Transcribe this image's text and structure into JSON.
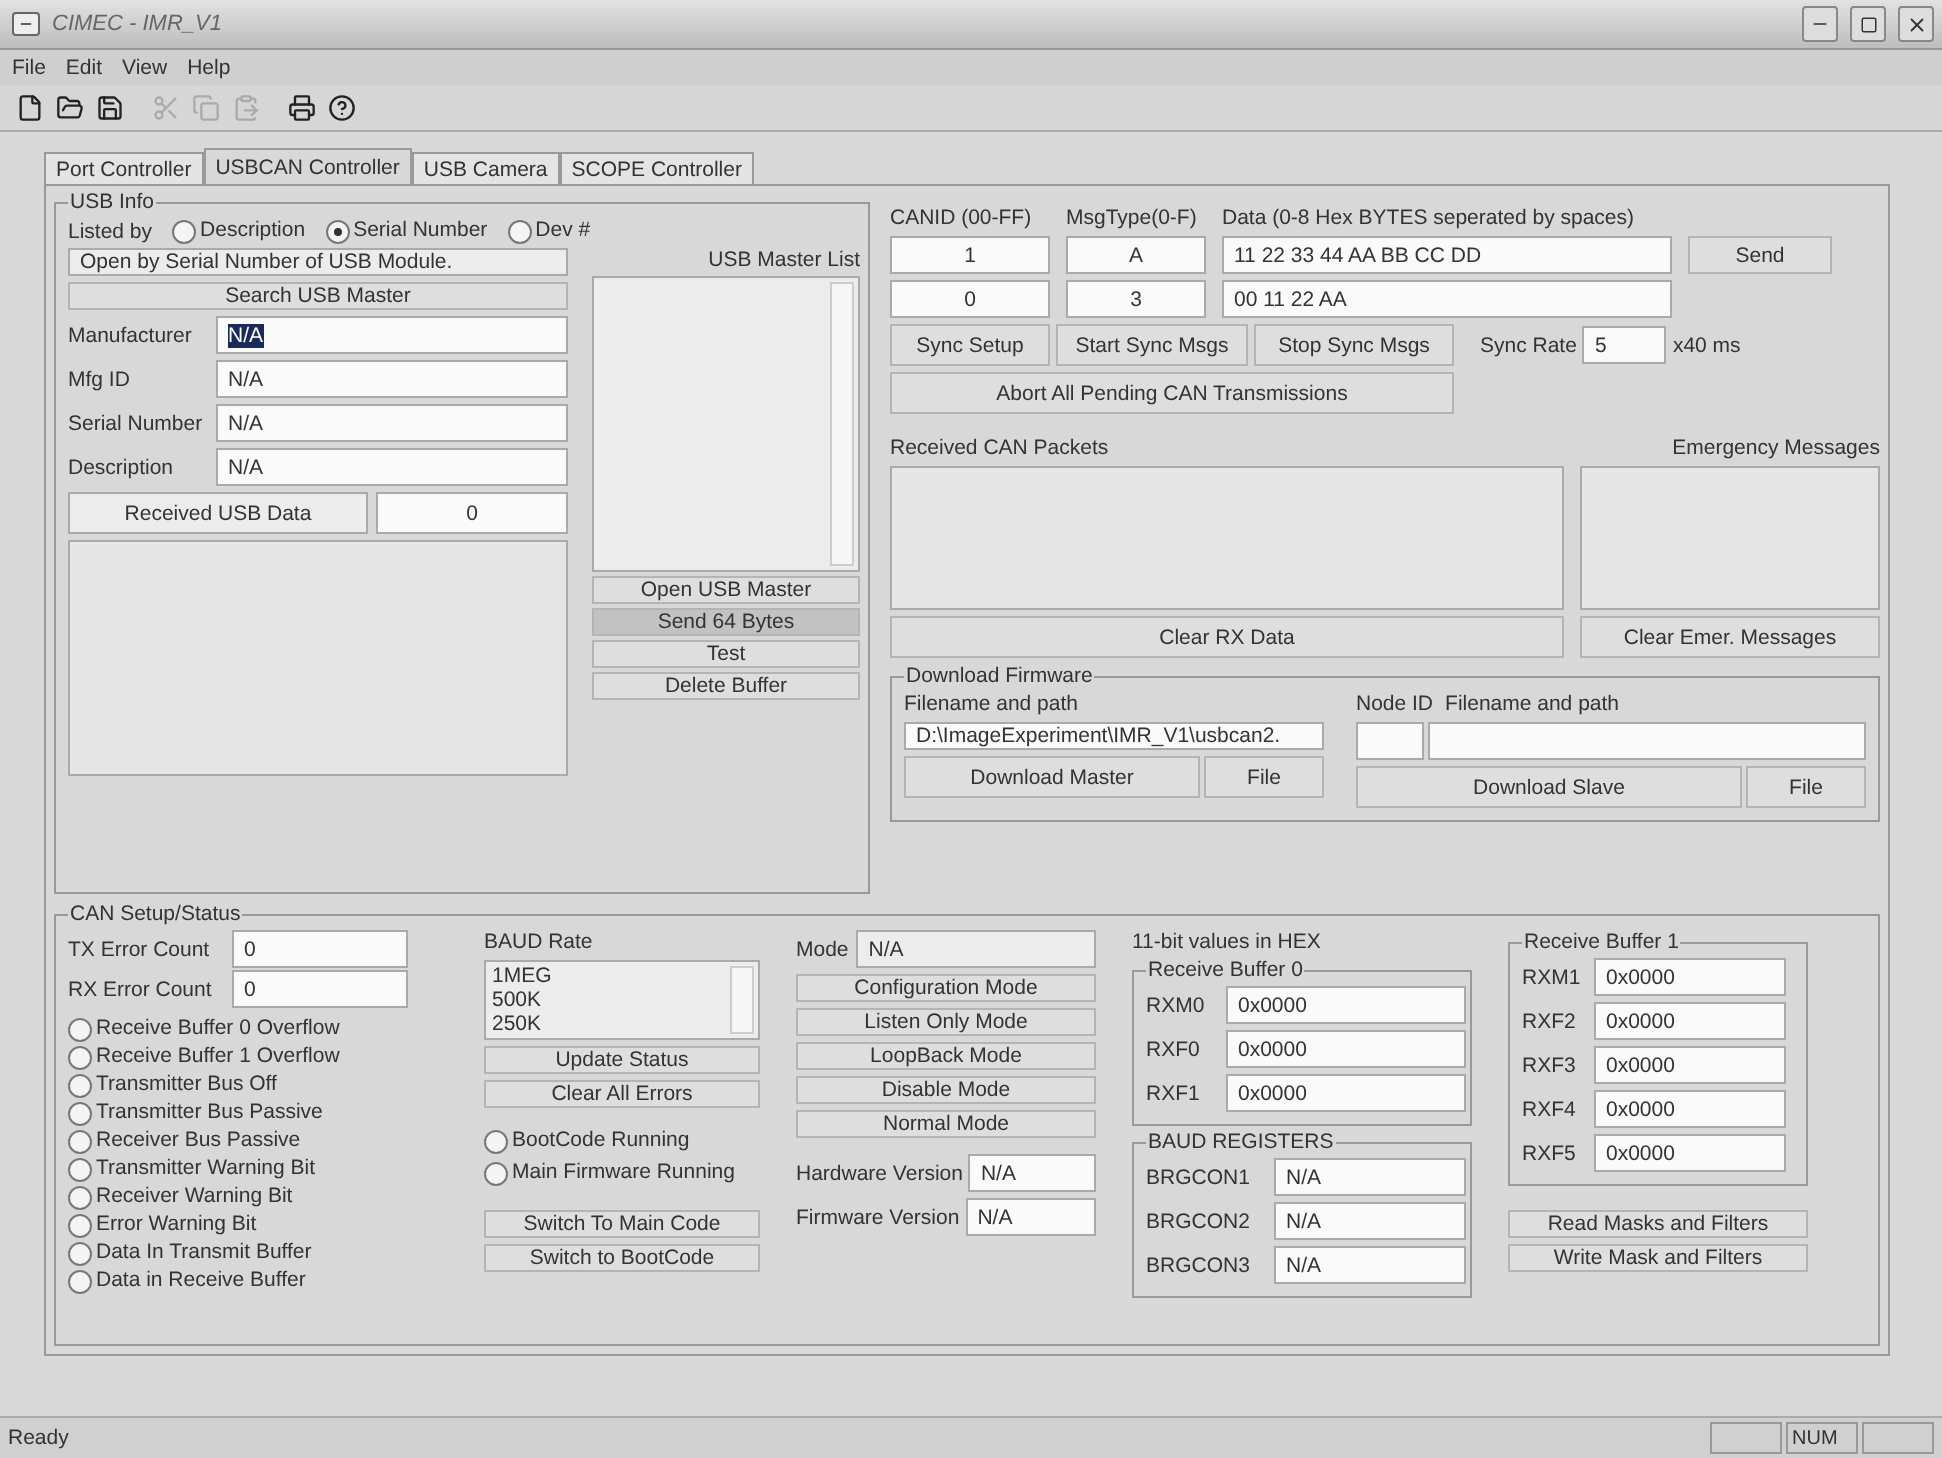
{
  "window": {
    "title": "CIMEC - IMR_V1"
  },
  "menu": [
    "File",
    "Edit",
    "View",
    "Help"
  ],
  "toolbar": [
    {
      "kind": "new",
      "disabled": false
    },
    {
      "kind": "open",
      "disabled": false
    },
    {
      "kind": "save",
      "disabled": false
    },
    {
      "kind": "cut",
      "disabled": true
    },
    {
      "kind": "copy",
      "disabled": true
    },
    {
      "kind": "paste",
      "disabled": true
    },
    {
      "kind": "print",
      "disabled": false
    },
    {
      "kind": "help",
      "disabled": false
    }
  ],
  "tabs": [
    {
      "label": "Port Controller",
      "selected": false
    },
    {
      "label": "USBCAN Controller",
      "selected": true
    },
    {
      "label": "USB Camera",
      "selected": false
    },
    {
      "label": "SCOPE Controller",
      "selected": false
    }
  ],
  "usb_info": {
    "title": "USB Info",
    "listed_by": "Listed by",
    "options": [
      {
        "label": "Description",
        "selected": false
      },
      {
        "label": "Serial Number",
        "selected": true
      },
      {
        "label": "Dev #",
        "selected": false
      }
    ],
    "master_list_label": "USB Master List",
    "hint": "Open by Serial Number of USB Module.",
    "search_button": "Search USB Master",
    "fields": [
      {
        "label": "Manufacturer",
        "value": "N/A",
        "highlighted": true
      },
      {
        "label": "Mfg ID",
        "value": "N/A",
        "highlighted": false
      },
      {
        "label": "Serial Number",
        "value": "N/A",
        "highlighted": false
      },
      {
        "label": "Description",
        "value": "N/A",
        "highlighted": false
      }
    ],
    "received_label": "Received USB Data",
    "received_count": "0",
    "buttons": [
      {
        "label": "Open USB Master",
        "pressed": false
      },
      {
        "label": "Send 64 Bytes",
        "pressed": true
      },
      {
        "label": "Test",
        "pressed": false
      },
      {
        "label": "Delete Buffer",
        "pressed": false
      }
    ]
  },
  "can_send": {
    "headers": [
      "CANID (00-FF)",
      "MsgType(0-F)",
      "Data (0-8 Hex BYTES seperated by spaces)"
    ],
    "rows": [
      {
        "canid": "1",
        "msgtype": "A",
        "data": "11 22 33 44 AA BB CC DD"
      },
      {
        "canid": "0",
        "msgtype": "3",
        "data": "00 11 22 AA"
      }
    ],
    "send_button": "Send",
    "sync_buttons": [
      "Sync Setup",
      "Start Sync Msgs",
      "Stop Sync Msgs"
    ],
    "sync_rate_label": "Sync Rate",
    "sync_rate": "5",
    "sync_rate_unit": "x40 ms",
    "abort_button": "Abort All Pending CAN Transmissions"
  },
  "received": {
    "packets_label": "Received CAN Packets",
    "emergency_label": "Emergency Messages",
    "clear_rx_button": "Clear RX Data",
    "clear_emer_button": "Clear Emer. Messages"
  },
  "firmware": {
    "title": "Download Firmware",
    "master_label": "Filename and path",
    "master_path": "D:\\ImageExperiment\\IMR_V1\\usbcan2.",
    "node_id_label": "Node ID",
    "slave_label": "Filename and path",
    "download_master": "Download Master",
    "master_file": "File",
    "download_slave": "Download Slave",
    "slave_file": "File"
  },
  "can_setup": {
    "title": "CAN Setup/Status",
    "tx_label": "TX Error Count",
    "tx_value": "0",
    "rx_label": "RX Error Count",
    "rx_value": "0",
    "flags": [
      {
        "label": "Receive Buffer 0 Overflow",
        "on": false
      },
      {
        "label": "Receive Buffer 1 Overflow",
        "on": false
      },
      {
        "label": "Transmitter Bus Off",
        "on": false
      },
      {
        "label": "Transmitter Bus Passive",
        "on": false
      },
      {
        "label": "Receiver Bus Passive",
        "on": false
      },
      {
        "label": "Transmitter Warning Bit",
        "on": false
      },
      {
        "label": "Receiver Warning Bit",
        "on": false
      },
      {
        "label": "Error Warning Bit",
        "on": false
      },
      {
        "label": "Data In Transmit Buffer",
        "on": false
      },
      {
        "label": "Data in Receive Buffer",
        "on": false
      }
    ],
    "baud_label": "BAUD Rate",
    "baud_options": [
      "1MEG",
      "500K",
      "250K"
    ],
    "status_buttons": [
      "Update Status",
      "Clear All Errors"
    ],
    "run_states": [
      {
        "label": "BootCode Running",
        "on": false
      },
      {
        "label": "Main Firmware Running",
        "on": false
      }
    ],
    "switch_buttons": [
      "Switch To Main Code",
      "Switch to BootCode"
    ],
    "mode_label": "Mode",
    "mode_value": "N/A",
    "mode_buttons": [
      "Configuration Mode",
      "Listen Only Mode",
      "LoopBack Mode",
      "Disable Mode",
      "Normal Mode"
    ],
    "versions": [
      {
        "label": "Hardware Version",
        "value": "N/A"
      },
      {
        "label": "Firmware Version",
        "value": "N/A"
      }
    ],
    "hex_label": "11-bit values in HEX",
    "buffer0": {
      "title": "Receive Buffer 0",
      "fields": [
        {
          "label": "RXM0",
          "value": "0x0000"
        },
        {
          "label": "RXF0",
          "value": "0x0000"
        },
        {
          "label": "RXF1",
          "value": "0x0000"
        }
      ]
    },
    "baud_registers": {
      "title": "BAUD REGISTERS",
      "fields": [
        {
          "label": "BRGCON1",
          "value": "N/A"
        },
        {
          "label": "BRGCON2",
          "value": "N/A"
        },
        {
          "label": "BRGCON3",
          "value": "N/A"
        }
      ]
    },
    "buffer1": {
      "title": "Receive Buffer 1",
      "fields": [
        {
          "label": "RXM1",
          "value": "0x0000"
        },
        {
          "label": "RXF2",
          "value": "0x0000"
        },
        {
          "label": "RXF3",
          "value": "0x0000"
        },
        {
          "label": "RXF4",
          "value": "0x0000"
        },
        {
          "label": "RXF5",
          "value": "0x0000"
        }
      ]
    },
    "mask_buttons": [
      "Read Masks and Filters",
      "Write Mask and Filters"
    ]
  },
  "status_bar": {
    "text": "Ready",
    "indicators": [
      "NUM"
    ]
  }
}
